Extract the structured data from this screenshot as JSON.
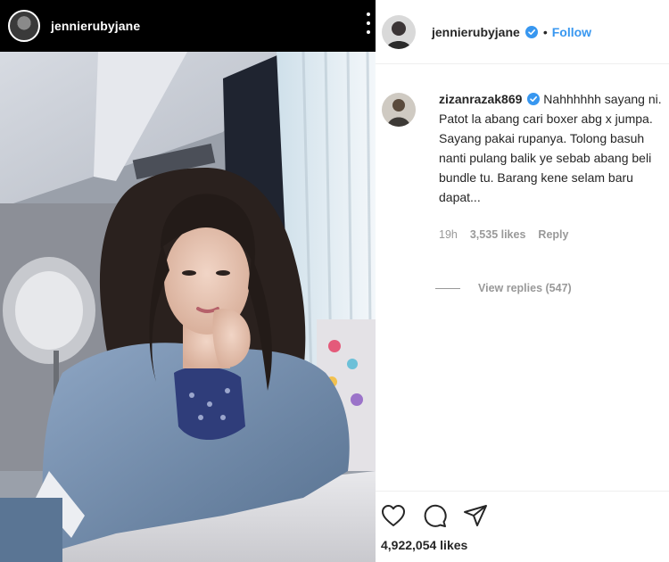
{
  "left_header": {
    "username": "jennierubyjane"
  },
  "post_header": {
    "username": "jennierubyjane",
    "separator": "•",
    "follow_label": "Follow"
  },
  "comment": {
    "username": "zizanrazak869",
    "text": " Nahhhhhh sayang ni. Patot la abang cari boxer abg x jumpa. Sayang pakai rupanya. Tolong basuh nanti pulang balik ye sebab abang beli bundle tu. Barang kene selam baru dapat...",
    "time": "19h",
    "likes": "3,535 likes",
    "reply_label": "Reply"
  },
  "replies": {
    "label": "View replies (547)"
  },
  "actions": {
    "icons": [
      "heart-icon",
      "comment-icon",
      "share-icon"
    ],
    "likes_count": "4,922,054 likes"
  },
  "colors": {
    "accent": "#3897f0",
    "text": "#262626",
    "muted": "#999999",
    "header_bg": "#000000"
  }
}
